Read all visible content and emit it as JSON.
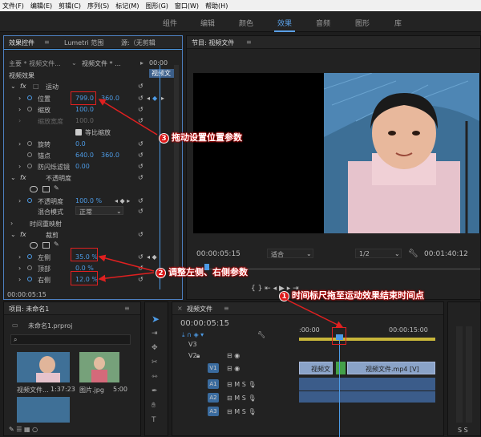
{
  "menubar": [
    "文件(F)",
    "编辑(E)",
    "剪辑(C)",
    "序列(S)",
    "标记(M)",
    "图形(G)",
    "窗口(W)",
    "帮助(H)"
  ],
  "workspace_tabs": [
    "组件",
    "编辑",
    "颜色",
    "效果",
    "音频",
    "图形",
    "库"
  ],
  "workspace_active": "效果",
  "effect_controls": {
    "tab_active": "效果控件",
    "tab_lumetri": "Lumetri 范围",
    "tab_source": "源:（无剪辑",
    "master": "主要 * 视频文件...",
    "clip": "视频文件 * ...",
    "timecode_top": "00:00",
    "clip_label": "视频文",
    "section_video": "视频效果",
    "motion": "运动",
    "position_label": "位置",
    "position_x": "799.0",
    "position_y": "360.0",
    "scale_label": "缩放",
    "scale_value": "100.0",
    "scale_width_label": "缩放宽度",
    "scale_width_value": "100.0",
    "uniform_scale": "等比缩放",
    "rotation_label": "旋转",
    "rotation_value": "0.0",
    "anchor_label": "锚点",
    "anchor_x": "640.0",
    "anchor_y": "360.0",
    "antiflicker_label": "防闪烁滤镜",
    "antiflicker_value": "0.00",
    "opacity_section": "不透明度",
    "opacity_label": "不透明度",
    "opacity_value": "100.0 %",
    "blend_label": "混合模式",
    "blend_value": "正常",
    "time_remap": "时间重映射",
    "crop": "裁剪",
    "left_label": "左侧",
    "left_value": "35.0 %",
    "top_label": "顶部",
    "top_value": "0.0 %",
    "right_label": "右侧",
    "right_value": "12.0 %",
    "timecode_bottom": "00:00:05:15"
  },
  "program_monitor": {
    "title": "节目: 视频文件",
    "timecode": "00:00:05:15",
    "fit": "适合",
    "quality": "1/2",
    "duration": "00:01:40:12"
  },
  "project": {
    "title": "项目: 未命名1",
    "project_file": "未命名1.prproj",
    "items": [
      {
        "name": "视频文件...",
        "duration": "1:37:23"
      },
      {
        "name": "图片.jpg",
        "duration": "5:00"
      }
    ]
  },
  "timeline": {
    "title": "视频文件",
    "timecode": "00:00:05:15",
    "ruler_start": ":00:00",
    "ruler_mid": "00:00:15:00",
    "tracks": [
      "V3",
      "V2",
      "V1",
      "A1",
      "A2",
      "A3"
    ],
    "clip_a": "视频文",
    "clip_b": "视频文件.mp4 [V]"
  },
  "callouts": {
    "c1_num": "1",
    "c1_text": "时间标尺拖至运动效果结束时间点",
    "c2_num": "2",
    "c2_text": "调整左侧、右侧参数",
    "c3_num": "3",
    "c3_text": "拖动设置位置参数"
  },
  "colors": {
    "accent": "#4d9be6",
    "callout": "#e02020"
  }
}
